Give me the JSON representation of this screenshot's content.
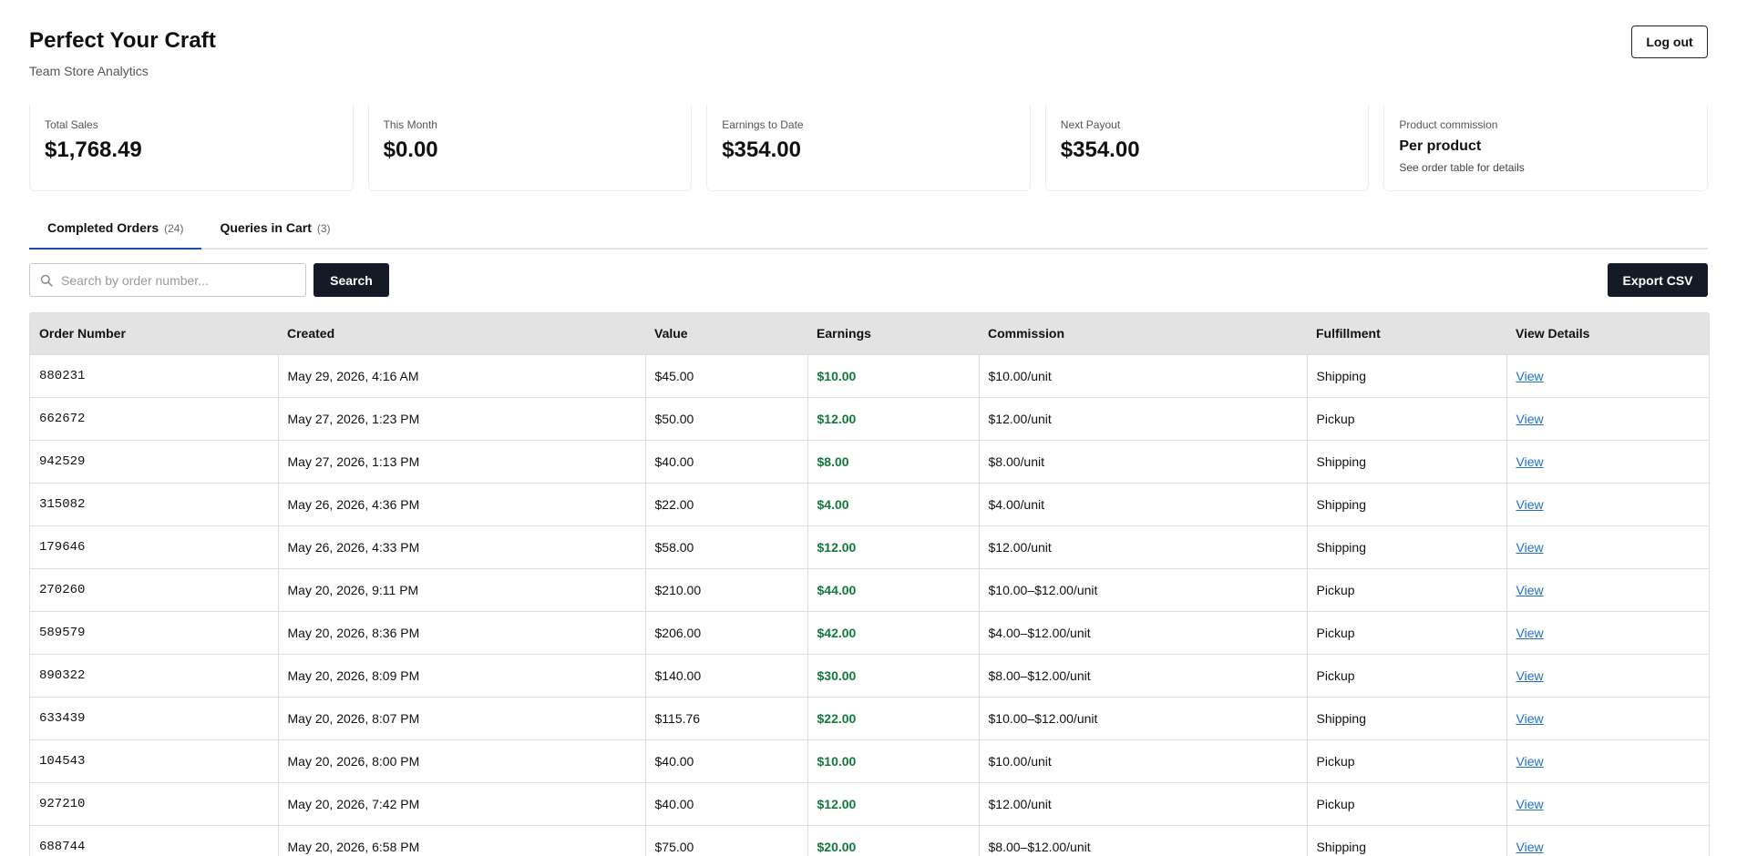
{
  "header": {
    "title": "Perfect Your Craft",
    "subtitle": "Team Store Analytics",
    "logout_label": "Log out"
  },
  "stats": [
    {
      "label": "Total Sales",
      "value": "$1,768.49"
    },
    {
      "label": "This Month",
      "value": "$0.00"
    },
    {
      "label": "Earnings to Date",
      "value": "$354.00"
    },
    {
      "label": "Next Payout",
      "value": "$354.00"
    },
    {
      "label": "Product commission",
      "value": "Per product",
      "note": "See order table for details"
    }
  ],
  "tabs": [
    {
      "label": "Completed Orders",
      "count": "(24)",
      "active": true
    },
    {
      "label": "Queries in Cart",
      "count": "(3)",
      "active": false
    }
  ],
  "toolbar": {
    "search_placeholder": "Search by order number...",
    "search_label": "Search",
    "export_label": "Export CSV"
  },
  "table": {
    "columns": [
      "Order Number",
      "Created",
      "Value",
      "Earnings",
      "Commission",
      "Fulfillment",
      "View Details"
    ],
    "rows": [
      {
        "order": "880231",
        "created": "May 29, 2026, 4:16 AM",
        "value": "$45.00",
        "earnings": "$10.00",
        "commission": "$10.00/unit",
        "fulfillment": "Shipping",
        "view": "View"
      },
      {
        "order": "662672",
        "created": "May 27, 2026, 1:23 PM",
        "value": "$50.00",
        "earnings": "$12.00",
        "commission": "$12.00/unit",
        "fulfillment": "Pickup",
        "view": "View"
      },
      {
        "order": "942529",
        "created": "May 27, 2026, 1:13 PM",
        "value": "$40.00",
        "earnings": "$8.00",
        "commission": "$8.00/unit",
        "fulfillment": "Shipping",
        "view": "View"
      },
      {
        "order": "315082",
        "created": "May 26, 2026, 4:36 PM",
        "value": "$22.00",
        "earnings": "$4.00",
        "commission": "$4.00/unit",
        "fulfillment": "Shipping",
        "view": "View"
      },
      {
        "order": "179646",
        "created": "May 26, 2026, 4:33 PM",
        "value": "$58.00",
        "earnings": "$12.00",
        "commission": "$12.00/unit",
        "fulfillment": "Shipping",
        "view": "View"
      },
      {
        "order": "270260",
        "created": "May 20, 2026, 9:11 PM",
        "value": "$210.00",
        "earnings": "$44.00",
        "commission": "$10.00–$12.00/unit",
        "fulfillment": "Pickup",
        "view": "View"
      },
      {
        "order": "589579",
        "created": "May 20, 2026, 8:36 PM",
        "value": "$206.00",
        "earnings": "$42.00",
        "commission": "$4.00–$12.00/unit",
        "fulfillment": "Pickup",
        "view": "View"
      },
      {
        "order": "890322",
        "created": "May 20, 2026, 8:09 PM",
        "value": "$140.00",
        "earnings": "$30.00",
        "commission": "$8.00–$12.00/unit",
        "fulfillment": "Pickup",
        "view": "View"
      },
      {
        "order": "633439",
        "created": "May 20, 2026, 8:07 PM",
        "value": "$115.76",
        "earnings": "$22.00",
        "commission": "$10.00–$12.00/unit",
        "fulfillment": "Shipping",
        "view": "View"
      },
      {
        "order": "104543",
        "created": "May 20, 2026, 8:00 PM",
        "value": "$40.00",
        "earnings": "$10.00",
        "commission": "$10.00/unit",
        "fulfillment": "Pickup",
        "view": "View"
      },
      {
        "order": "927210",
        "created": "May 20, 2026, 7:42 PM",
        "value": "$40.00",
        "earnings": "$12.00",
        "commission": "$12.00/unit",
        "fulfillment": "Pickup",
        "view": "View"
      },
      {
        "order": "688744",
        "created": "May 20, 2026, 6:58 PM",
        "value": "$75.00",
        "earnings": "$20.00",
        "commission": "$8.00–$12.00/unit",
        "fulfillment": "Shipping",
        "view": "View"
      }
    ]
  },
  "colors": {
    "primary_button": "#141a26",
    "active_tab_underline": "#1e4fa8",
    "earnings_text": "#117a3a",
    "link": "#1f6fd0",
    "table_header_bg": "#e3e3e3"
  }
}
